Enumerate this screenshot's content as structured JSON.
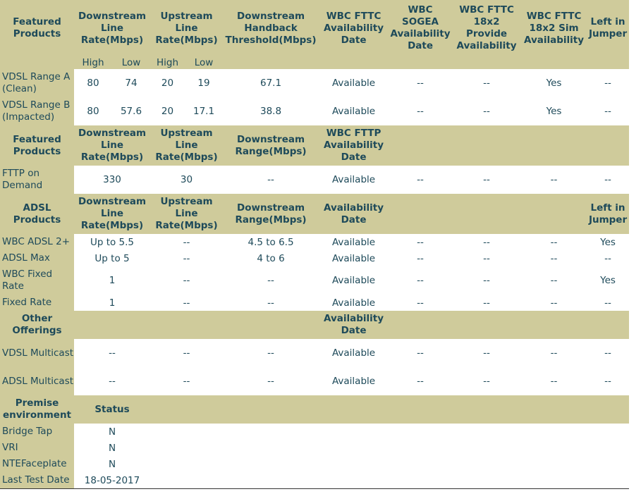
{
  "vdsl": {
    "headers": [
      "Featured Products",
      "Downstream Line Rate(Mbps)",
      "Upstream Line Rate(Mbps)",
      "Downstream Handback Threshold(Mbps)",
      "WBC FTTC Availability Date",
      "WBC SOGEA Availability Date",
      "WBC FTTC 18x2 Provide Availability",
      "WBC FTTC 18x2 Sim Availability",
      "Left in Jumper"
    ],
    "sub": [
      "High",
      "Low",
      "High",
      "Low"
    ],
    "rows": [
      {
        "label": "VDSL Range A (Clean)",
        "cells": [
          "80",
          "74",
          "20",
          "19",
          "67.1",
          "Available",
          "--",
          "--",
          "Yes",
          "--"
        ]
      },
      {
        "label": "VDSL Range B (Impacted)",
        "cells": [
          "80",
          "57.6",
          "20",
          "17.1",
          "38.8",
          "Available",
          "--",
          "--",
          "Yes",
          "--"
        ]
      }
    ]
  },
  "fttp": {
    "headers": [
      "Featured Products",
      "Downstream Line Rate(Mbps)",
      "Upstream Line Rate(Mbps)",
      "Downstream Range(Mbps)",
      "WBC FTTP Availability Date"
    ],
    "rows": [
      {
        "label": "FTTP on Demand",
        "cells": [
          "330",
          "30",
          "--",
          "Available",
          "--",
          "--",
          "--",
          "--"
        ]
      }
    ]
  },
  "adsl": {
    "headers": [
      "ADSL Products",
      "Downstream Line Rate(Mbps)",
      "Upstream Line Rate(Mbps)",
      "Downstream Range(Mbps)",
      "Availability Date",
      "Left in Jumper"
    ],
    "rows": [
      {
        "label": "WBC ADSL 2+",
        "cells": [
          "Up to 5.5",
          "--",
          "4.5 to 6.5",
          "Available",
          "--",
          "--",
          "--",
          "Yes"
        ]
      },
      {
        "label": "ADSL Max",
        "cells": [
          "Up to 5",
          "--",
          "4 to 6",
          "Available",
          "--",
          "--",
          "--",
          "--"
        ]
      },
      {
        "label": "WBC Fixed Rate",
        "cells": [
          "1",
          "--",
          "--",
          "Available",
          "--",
          "--",
          "--",
          "Yes"
        ]
      },
      {
        "label": "Fixed Rate",
        "cells": [
          "1",
          "--",
          "--",
          "Available",
          "--",
          "--",
          "--",
          "--"
        ]
      }
    ]
  },
  "other": {
    "headers": [
      "Other Offerings",
      "Availability Date"
    ],
    "rows": [
      {
        "label": "VDSL Multicast",
        "cells": [
          "--",
          "--",
          "--",
          "Available",
          "--",
          "--",
          "--",
          "--"
        ]
      },
      {
        "label": "ADSL Multicast",
        "cells": [
          "--",
          "--",
          "--",
          "Available",
          "--",
          "--",
          "--",
          "--"
        ]
      }
    ]
  },
  "premise": {
    "headers": [
      "Premise environment",
      "Status"
    ],
    "rows": [
      {
        "label": "Bridge Tap",
        "value": "N"
      },
      {
        "label": "VRI",
        "value": "N"
      },
      {
        "label": "NTEFaceplate",
        "value": "N"
      },
      {
        "label": "Last Test Date",
        "value": "18-05-2017"
      }
    ]
  }
}
